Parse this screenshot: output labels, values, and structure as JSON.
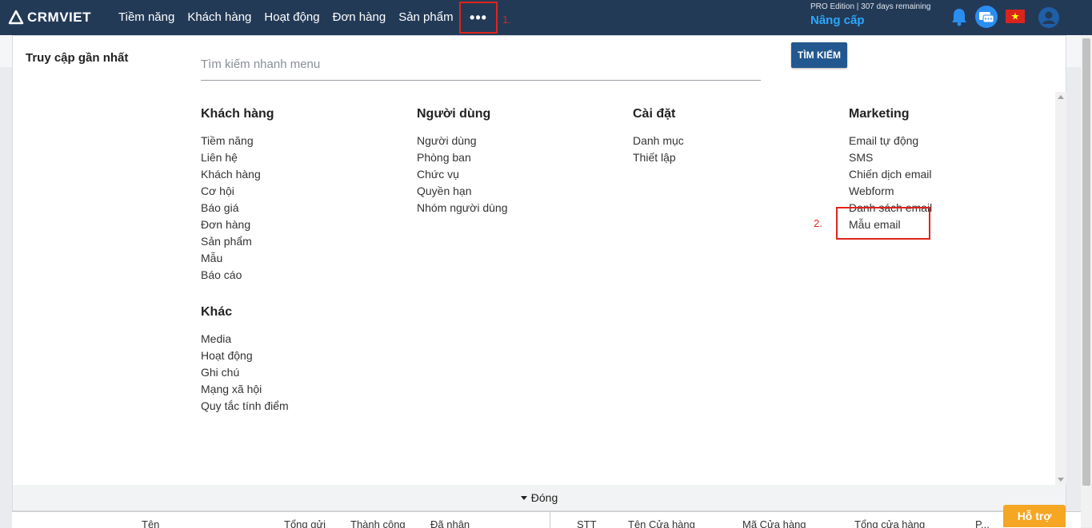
{
  "app": {
    "logo_text": "CRMVIET"
  },
  "nav": {
    "items": [
      "Tiềm năng",
      "Khách hàng",
      "Hoạt động",
      "Đơn hàng",
      "Sản phẩm"
    ],
    "more_label": "•••"
  },
  "annotations": {
    "step1": "1.",
    "step2": "2."
  },
  "account": {
    "edition": "PRO Edition | 307 days remaining",
    "upgrade_label": "Nâng cấp"
  },
  "menu_panel": {
    "recent_title": "Truy cập gần nhất",
    "search_placeholder": "Tìm kiếm nhanh menu",
    "search_button": "TÌM KIẾM",
    "columns": [
      {
        "title": "Khách hàng",
        "items": [
          "Tiềm năng",
          "Liên hệ",
          "Khách hàng",
          "Cơ hội",
          "Báo giá",
          "Đơn hàng",
          "Sản phẩm",
          "Mẫu",
          "Báo cáo"
        ]
      },
      {
        "title": "Người dùng",
        "items": [
          "Người dùng",
          "Phòng ban",
          "Chức vụ",
          "Quyền hạn",
          "Nhóm người dùng"
        ]
      },
      {
        "title": "Cài đặt",
        "items": [
          "Danh mục",
          "Thiết lập"
        ]
      },
      {
        "title": "Marketing",
        "items": [
          "Email tự động",
          "SMS",
          "Chiến dịch email",
          "Webform",
          "Danh sách email",
          "Mẫu email"
        ]
      },
      {
        "title": "Khác",
        "items": [
          "Media",
          "Hoạt động",
          "Ghi chú",
          "Mạng xã hội",
          "Quy tắc tính điểm"
        ]
      }
    ],
    "close_label": "Đóng"
  },
  "background_table": {
    "left_headers": [
      "Tên",
      "Tổng gửi",
      "Thành công",
      "Đã nhận"
    ],
    "right_headers": [
      "STT",
      "Tên Cửa hàng",
      "Mã Cửa hàng",
      "Tổng cửa hàng",
      "P..."
    ]
  },
  "support_label": "Hỗ trợ",
  "colors": {
    "topbar": "#233a57",
    "upgrade": "#2aa8ff",
    "search_button": "#23578f",
    "highlight": "#e0231b",
    "support": "#f5a623"
  }
}
